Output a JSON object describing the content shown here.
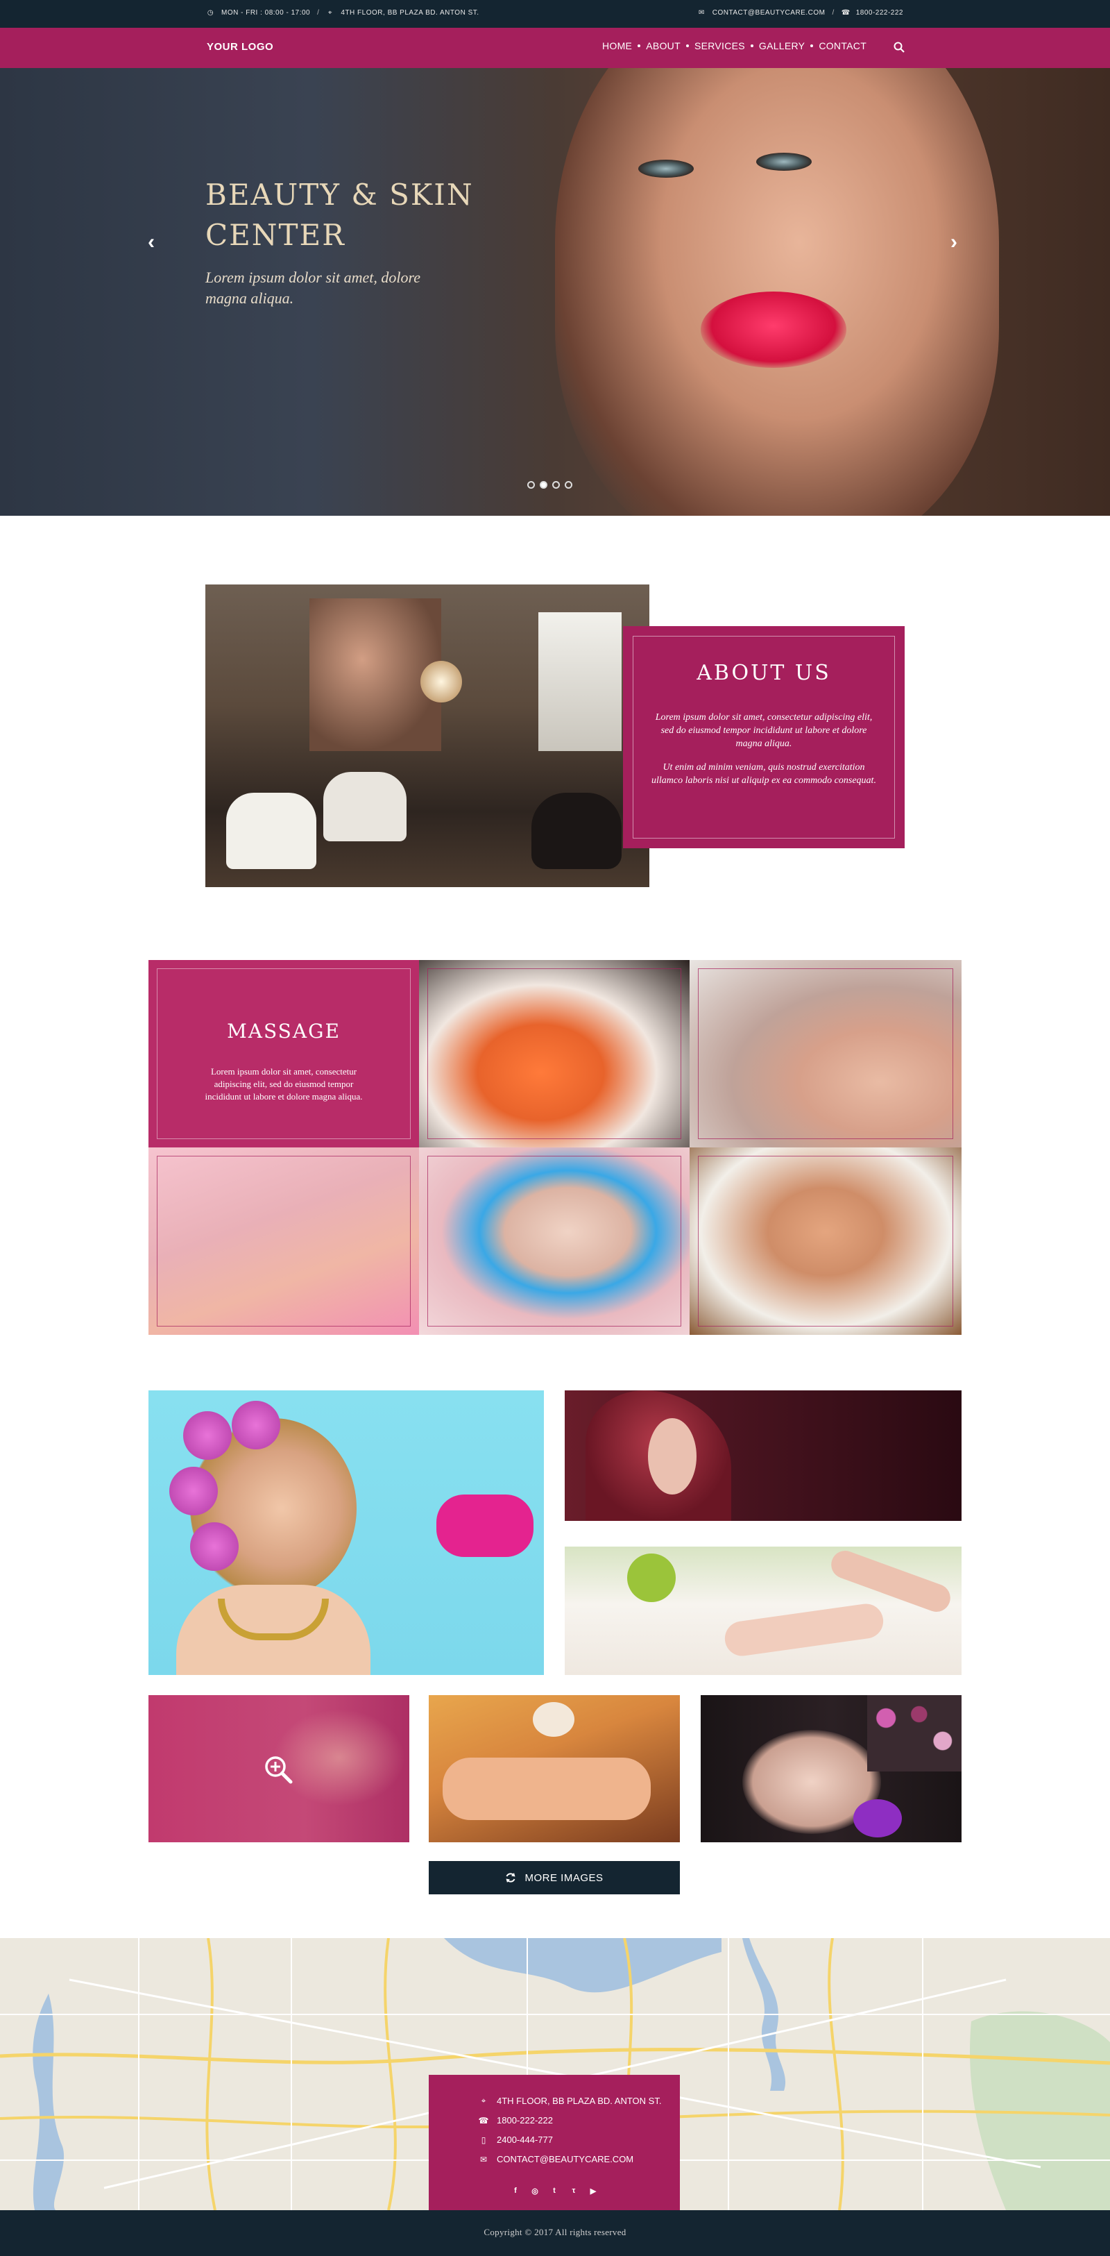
{
  "topbar": {
    "hours": "MON - FRI : 08:00 - 17:00",
    "address": "4TH FLOOR, BB PLAZA BD. ANTON ST.",
    "email": "CONTACT@BEAUTYCARE.COM",
    "phone": "1800-222-222"
  },
  "nav": {
    "logo": "YOUR LOGO",
    "items": [
      "HOME",
      "ABOUT",
      "SERVICES",
      "GALLERY",
      "CONTACT"
    ]
  },
  "hero": {
    "title": "BEAUTY & SKIN CENTER",
    "subtitle": "Lorem ipsum dolor sit amet, dolore magna aliqua.",
    "slides": 4,
    "active_slide": 2
  },
  "about": {
    "title": "ABOUT US",
    "p1": "Lorem ipsum dolor sit amet, consectetur adipiscing elit, sed do eiusmod tempor incididunt ut labore et dolore magna aliqua.",
    "p2": "Ut enim ad minim veniam, quis nostrud exercitation ullamco laboris nisi ut aliquip ex ea commodo consequat."
  },
  "services": {
    "massage_title": "MASSAGE",
    "massage_text": "Lorem ipsum dolor sit amet, consectetur adipiscing elit, sed do eiusmod tempor incididunt ut labore et dolore magna aliqua."
  },
  "gallery": {
    "more_label": "MORE IMAGES"
  },
  "contact": {
    "address": "4TH FLOOR, BB PLAZA BD. ANTON ST.",
    "phone1": "1800-222-222",
    "phone2": "2400-444-777",
    "email": "CONTACT@BEAUTYCARE.COM",
    "social": [
      "facebook-icon",
      "instagram-icon",
      "twitter-icon",
      "tumblr-icon",
      "youtube-icon"
    ]
  },
  "footer": {
    "copyright": "Copyright © 2017 All rights reserved"
  },
  "colors": {
    "brand": "#a51f5c",
    "dark": "#142531"
  }
}
